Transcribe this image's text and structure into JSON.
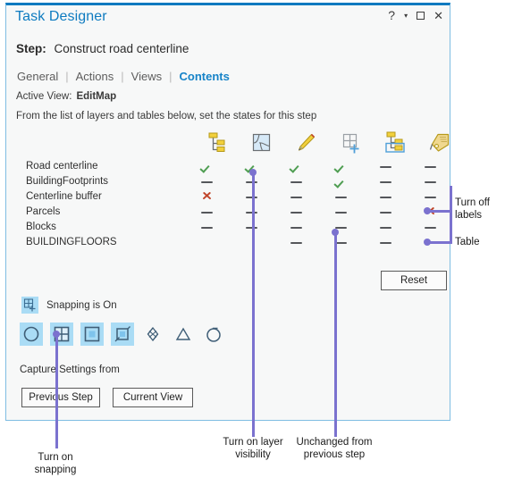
{
  "window": {
    "title": "Task Designer",
    "controls": [
      {
        "name": "help",
        "glyph": "?"
      },
      {
        "name": "dropdown",
        "glyph": "▾"
      },
      {
        "name": "maximize",
        "glyph": ""
      },
      {
        "name": "close",
        "glyph": "✕"
      }
    ],
    "accent_color": "#0d7ac0",
    "border_color": "#7fbde2",
    "background": "#f7f8f8"
  },
  "step": {
    "label": "Step:",
    "value": "Construct road centerline"
  },
  "tabs": {
    "items": [
      {
        "label": "General",
        "active": false
      },
      {
        "label": "Actions",
        "active": false
      },
      {
        "label": "Views",
        "active": false
      },
      {
        "label": "Contents",
        "active": true
      }
    ],
    "separator": "|"
  },
  "active_view": {
    "label": "Active View:",
    "value": "EditMap"
  },
  "hint": "From the list of layers and tables below, set the states for this step",
  "matrix": {
    "columns": [
      {
        "icon": "layer-list-icon",
        "name": "contents-list"
      },
      {
        "icon": "map-visibility-icon",
        "name": "layer-visibility"
      },
      {
        "icon": "pencil-edit-icon",
        "name": "editable"
      },
      {
        "icon": "grid-plus-snapping-icon",
        "name": "snapping"
      },
      {
        "icon": "selectable-layer-icon",
        "name": "selectable"
      },
      {
        "icon": "label-tag-icon",
        "name": "labels"
      }
    ],
    "rows": [
      {
        "label": "Road centerline",
        "states": [
          "check",
          "check",
          "check",
          "check",
          "dash",
          "dash"
        ]
      },
      {
        "label": "BuildingFootprints",
        "states": [
          "dash",
          "dash",
          "dash",
          "check",
          "dash",
          "dash"
        ]
      },
      {
        "label": "Centerline buffer",
        "states": [
          "x",
          "dash",
          "dash",
          "dash",
          "dash",
          "dash"
        ]
      },
      {
        "label": "Parcels",
        "states": [
          "dash",
          "dash",
          "dash",
          "dash",
          "dash",
          "x"
        ]
      },
      {
        "label": "Blocks",
        "states": [
          "dash",
          "dash",
          "dash",
          "dash",
          "dash",
          "dash"
        ]
      },
      {
        "label": "BUILDINGFLOORS",
        "states": [
          "blank",
          "blank",
          "dash",
          "dash",
          "dash",
          "blank"
        ]
      }
    ]
  },
  "reset_button": "Reset",
  "snapping": {
    "status_label": "Snapping is On",
    "status_icon": "snapping-grid-plus-icon",
    "tools": [
      {
        "name": "point-snap-icon",
        "on": true
      },
      {
        "name": "vertex-grid-snap-icon",
        "on": true
      },
      {
        "name": "edge-snap-icon",
        "on": true
      },
      {
        "name": "end-snap-icon",
        "on": true
      },
      {
        "name": "intersection-snap-icon",
        "on": false
      },
      {
        "name": "midpoint-snap-icon",
        "on": false
      },
      {
        "name": "tangent-snap-icon",
        "on": false
      }
    ]
  },
  "capture": {
    "label": "Capture Settings from",
    "previous_step_button": "Previous Step",
    "current_view_button": "Current View"
  },
  "annotations": {
    "color": "#7b72cf",
    "items": [
      {
        "name": "turn-off-labels",
        "text": "Turn off\nlabels"
      },
      {
        "name": "table",
        "text": "Table"
      },
      {
        "name": "turn-on-snapping",
        "text": "Turn on\nsnapping"
      },
      {
        "name": "turn-on-layer-visibility",
        "text": "Turn on layer\nvisibility"
      },
      {
        "name": "unchanged-from-previous-step",
        "text": "Unchanged from\nprevious step"
      }
    ]
  }
}
